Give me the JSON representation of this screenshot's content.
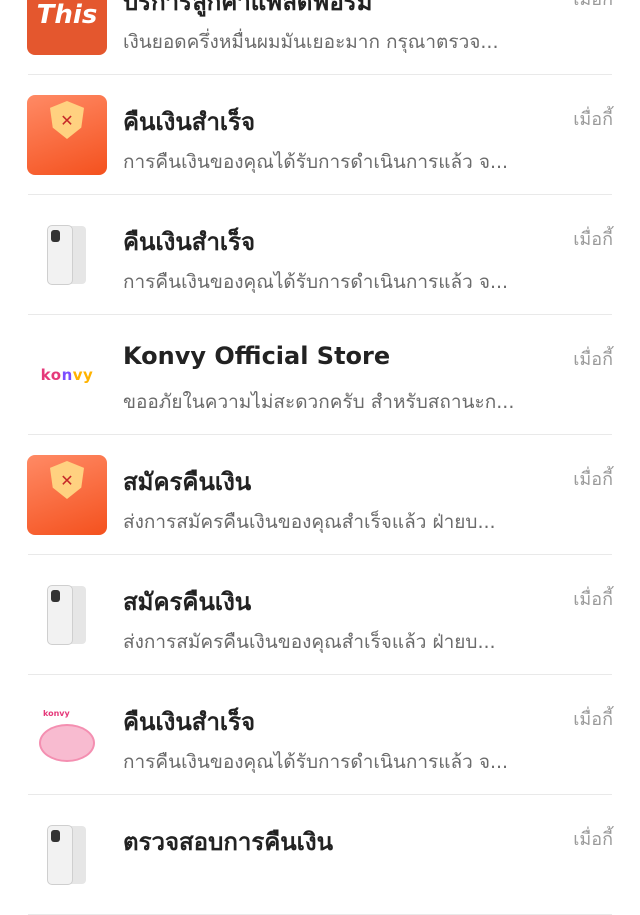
{
  "messages": [
    {
      "title": "บริการลูกค้าแพลตฟอร์ม",
      "preview": "เงินยอดครึ่งหมื่นผมมันเยอะมาก กรุณาตรวจ...",
      "time": "เมื่อกี้",
      "thumb": "this-logo",
      "thumb_text": "This"
    },
    {
      "title": "คืนเงินสำเร็จ",
      "preview": "การคืนเงินของคุณได้รับการดำเนินการแล้ว จ...",
      "time": "เมื่อกี้",
      "thumb": "promo-shield"
    },
    {
      "title": "คืนเงินสำเร็จ",
      "preview": "การคืนเงินของคุณได้รับการดำเนินการแล้ว จ...",
      "time": "เมื่อกี้",
      "thumb": "phone"
    },
    {
      "title": "Konvy  Official Store",
      "preview": "ขออภัยในความไม่สะดวกครับ สำหรับสถานะก...",
      "time": "เมื่อกี้",
      "thumb": "konvy-logo"
    },
    {
      "title": "สมัครคืนเงิน",
      "preview": "ส่งการสมัครคืนเงินของคุณสำเร็จแล้ว ฝ่ายบ...",
      "time": "เมื่อกี้",
      "thumb": "promo-shield"
    },
    {
      "title": "สมัครคืนเงิน",
      "preview": "ส่งการสมัครคืนเงินของคุณสำเร็จแล้ว ฝ่ายบ...",
      "time": "เมื่อกี้",
      "thumb": "phone"
    },
    {
      "title": "คืนเงินสำเร็จ",
      "preview": "การคืนเงินของคุณได้รับการดำเนินการแล้ว จ...",
      "time": "เมื่อกี้",
      "thumb": "cushion"
    },
    {
      "title": "ตรวจสอบการคืนเงิน",
      "preview": "",
      "time": "เมื่อกี้",
      "thumb": "phone"
    }
  ],
  "colors": {
    "accent": "#e4572e",
    "title": "#222222",
    "preview": "#6b6b6b",
    "time": "#9a9a9a"
  }
}
